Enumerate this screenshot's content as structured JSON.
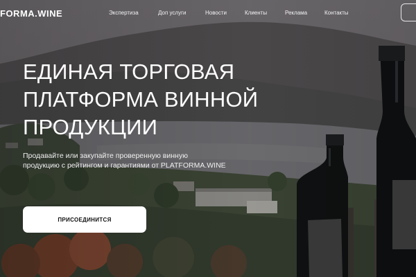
{
  "header": {
    "logo": "FORMA.WINE",
    "nav": [
      {
        "label": "Экспертиза"
      },
      {
        "label": "Доп услуги"
      },
      {
        "label": "Новости"
      },
      {
        "label": "Клиенты"
      },
      {
        "label": "Реклама"
      },
      {
        "label": "Контакты"
      }
    ]
  },
  "hero": {
    "title_lines": [
      "ЕДИНАЯ ТОРГОВАЯ",
      "ПЛАТФОРМА ВИННОЙ",
      "ПРОДУКЦИИ"
    ],
    "subtitle_lines": [
      "Продавайте или закупайте проверенную винную",
      "продукцию с рейтингом и гарантиями от PLATFORMA.WINE"
    ],
    "cta_label": "ПРИСОЕДИНИТСЯ"
  }
}
